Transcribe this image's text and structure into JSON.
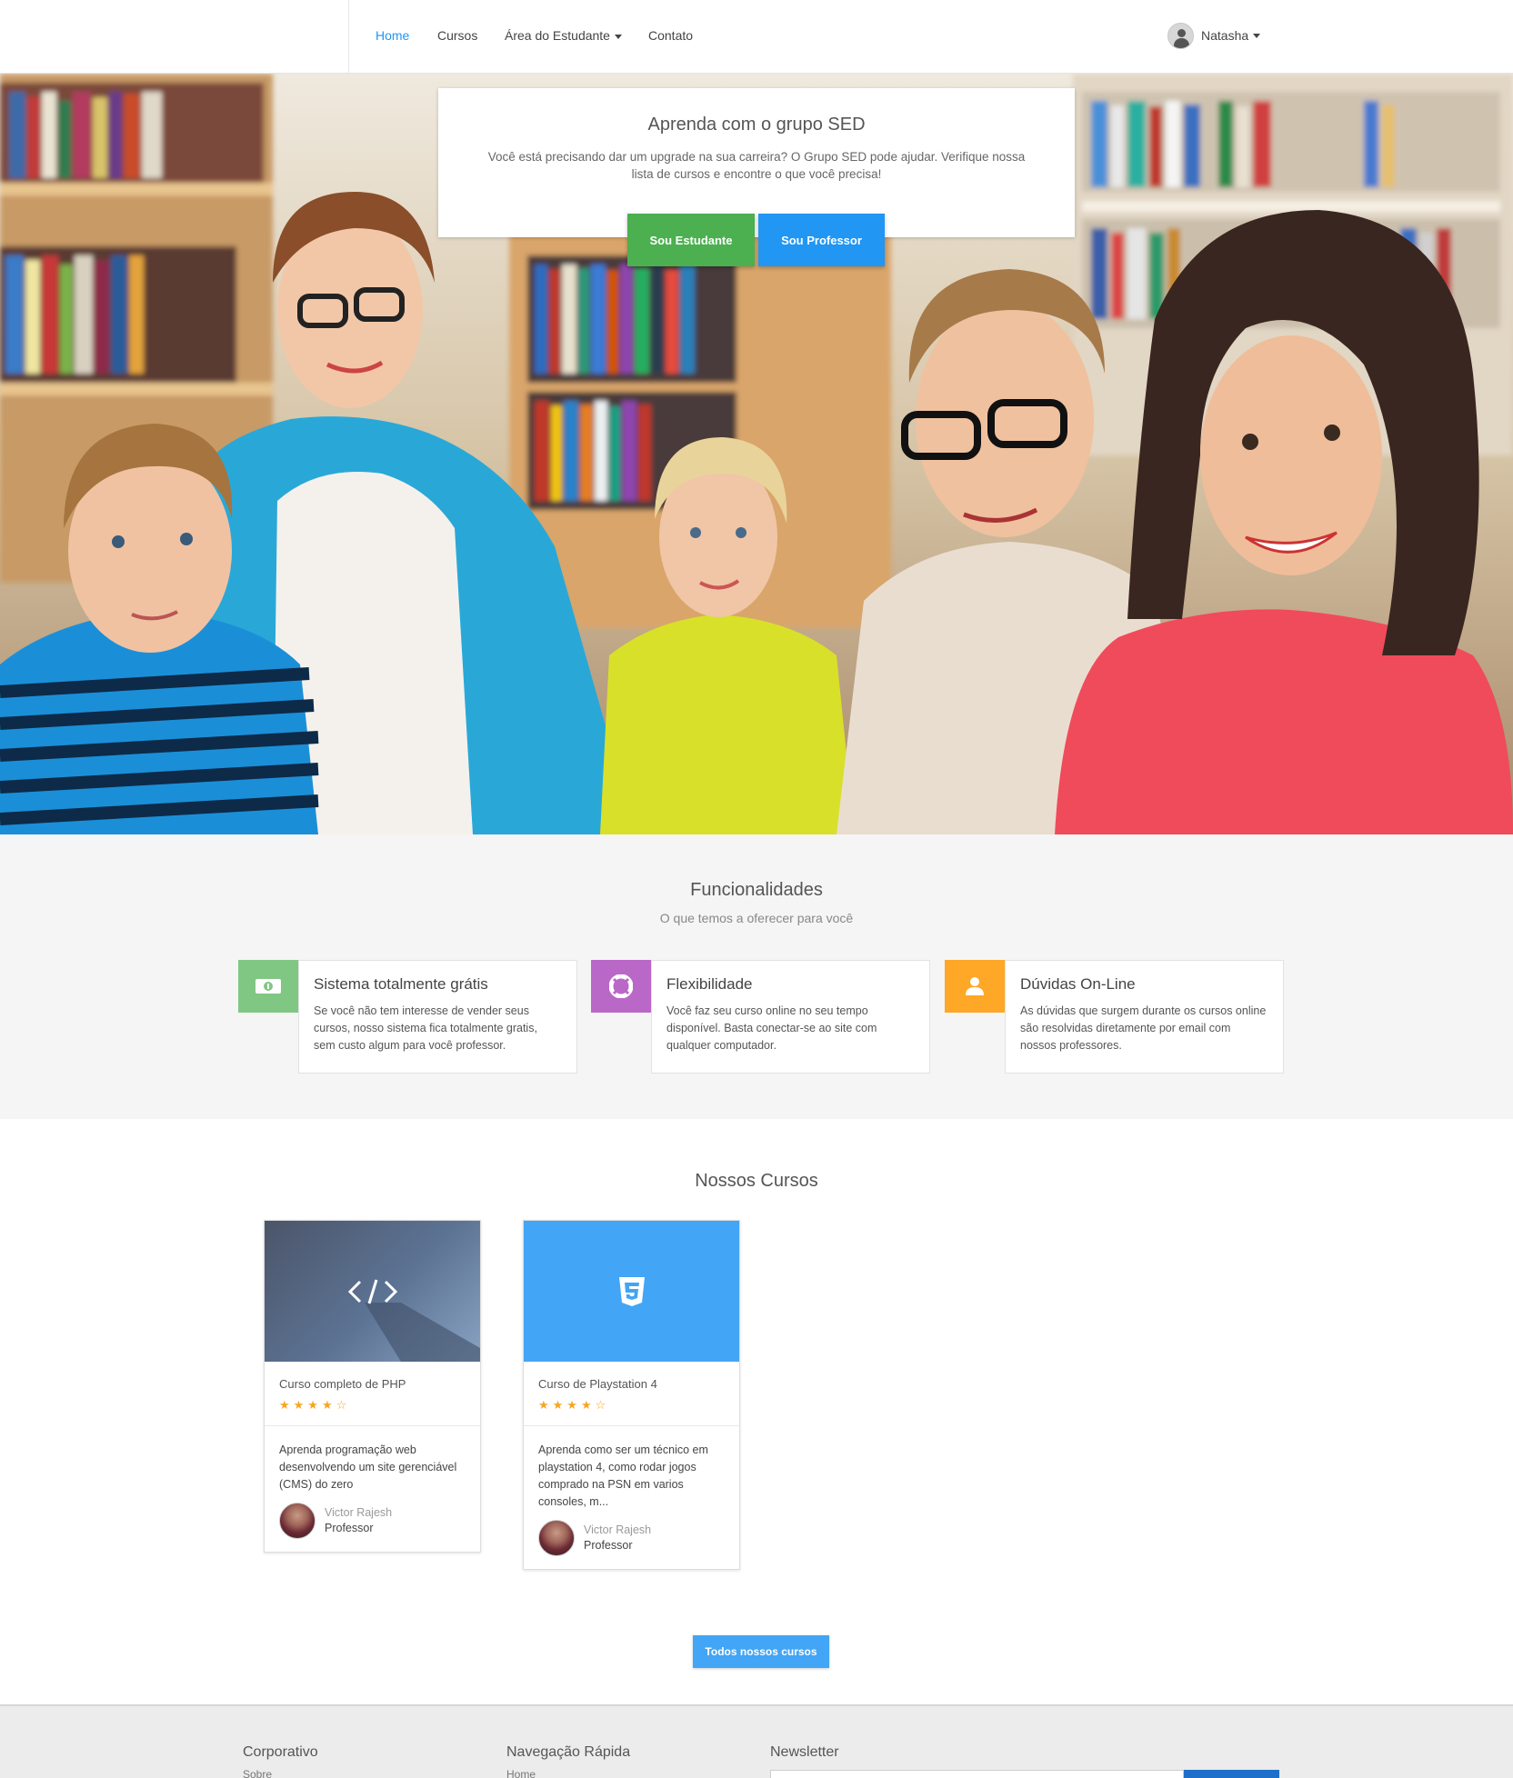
{
  "nav": {
    "items": [
      {
        "label": "Home",
        "active": true
      },
      {
        "label": "Cursos"
      },
      {
        "label": "Área do Estudante",
        "dropdown": true
      },
      {
        "label": "Contato"
      }
    ],
    "user": {
      "name": "Natasha"
    }
  },
  "hero": {
    "title": "Aprenda com o grupo SED",
    "text": "Você está precisando dar um upgrade na sua carreira? O Grupo SED pode ajudar. Verifique nossa lista de cursos e encontre o que você precisa!",
    "student_button": "Sou Estudante",
    "teacher_button": "Sou Professor"
  },
  "features": {
    "title": "Funcionalidades",
    "subtitle": "O que temos a oferecer para você",
    "items": [
      {
        "icon": "money-icon",
        "color": "#81c784",
        "title": "Sistema totalmente grátis",
        "text": "Se você não tem interesse de vender seus cursos, nosso sistema fica totalmente gratis, sem custo algum para você professor."
      },
      {
        "icon": "lifebuoy-icon",
        "color": "#ba68c8",
        "title": "Flexibilidade",
        "text": "Você faz seu curso online no seu tempo disponível. Basta conectar-se ao site com qualquer computador."
      },
      {
        "icon": "user-icon",
        "color": "#ffa726",
        "title": "Dúvidas On-Line",
        "text": "As dúvidas que surgem durante os cursos online são resolvidas diretamente por email com nossos professores."
      }
    ]
  },
  "courses": {
    "title": "Nossos Cursos",
    "items": [
      {
        "name": "Curso completo de PHP",
        "rating": 4,
        "stars": "★★★★☆",
        "icon": "code-icon",
        "description": "Aprenda programação web desenvolvendo um site gerenciável (CMS) do zero",
        "author": "Victor Rajesh",
        "role": "Professor"
      },
      {
        "name": "Curso de Playstation 4",
        "rating": 4,
        "stars": "★★★★☆",
        "icon": "css3-icon",
        "description": "Aprenda como ser um técnico em playstation 4, como rodar jogos comprado na PSN em varios consoles, m...",
        "author": "Victor Rajesh",
        "role": "Professor"
      }
    ],
    "all_button": "Todos nossos cursos"
  },
  "footer": {
    "columns": [
      {
        "title": "Corporativo",
        "first_link": "Sobre"
      },
      {
        "title": "Navegação Rápida",
        "first_link": "Home"
      },
      {
        "title": "Newsletter"
      }
    ]
  }
}
